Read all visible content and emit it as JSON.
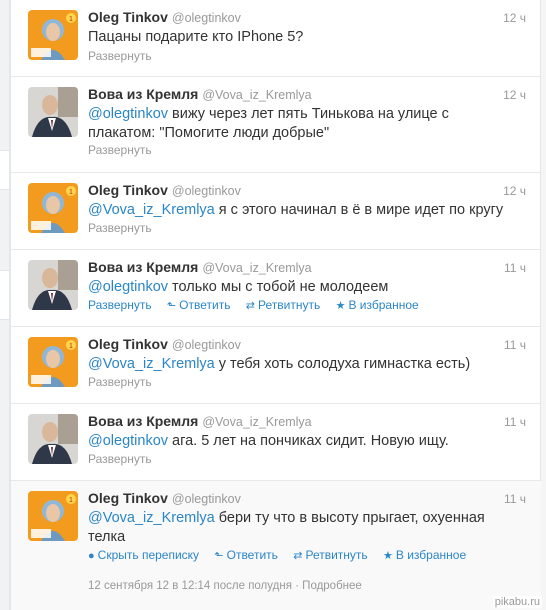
{
  "tweets": [
    {
      "name": "Oleg Tinkov",
      "handle": "@olegtinkov",
      "time": "12 ч",
      "mention": "",
      "text": "Пацаны подарите кто IPhone 5?",
      "expand": "Развернуть"
    },
    {
      "name": "Вова из Кремля",
      "handle": "@Vova_iz_Kremlya",
      "time": "12 ч",
      "mention": "@olegtinkov",
      "text": " вижу через лет пять Тинькова на улице с плакатом: \"Помогите люди добрые\"",
      "expand": "Развернуть"
    },
    {
      "name": "Oleg Tinkov",
      "handle": "@olegtinkov",
      "time": "12 ч",
      "mention": "@Vova_iz_Kremlya",
      "text": " я с этого начинал в ё в мире идет по кругу",
      "expand": "Развернуть"
    },
    {
      "name": "Вова из Кремля",
      "handle": "@Vova_iz_Kremlya",
      "time": "11 ч",
      "mention": "@olegtinkov",
      "text": " только мы с тобой не молодеем",
      "expand": "Развернуть",
      "reply": "Ответить",
      "retweet": "Ретвитнуть",
      "favorite": "В избранное"
    },
    {
      "name": "Oleg Tinkov",
      "handle": "@olegtinkov",
      "time": "11 ч",
      "mention": "@Vova_iz_Kremlya",
      "text": " у тебя хоть солодуха гимнастка есть)",
      "expand": "Развернуть"
    },
    {
      "name": "Вова из Кремля",
      "handle": "@Vova_iz_Kremlya",
      "time": "11 ч",
      "mention": "@olegtinkov",
      "text": " ага. 5 лет на пончиках сидит. Новую ищу.",
      "expand": "Развернуть"
    },
    {
      "name": "Oleg Tinkov",
      "handle": "@olegtinkov",
      "time": "11 ч",
      "mention": "@Vova_iz_Kremlya",
      "text": " бери ту что в высоту прыгает, охуенная телка",
      "hide": "Скрыть переписку",
      "reply": "Ответить",
      "retweet": "Ретвитнуть",
      "favorite": "В избранное",
      "date": "12 сентября 12 в 12:14 после полудня",
      "sep": " · ",
      "details": "Подробнее"
    }
  ],
  "avatar_text": {
    "badge": "1",
    "caption": "КАК СТАТЬ\nМИЛЛИОНЕРОМ"
  },
  "watermark": "pikabu.ru",
  "colors": {
    "link": "#2a86c7",
    "muted": "#999999",
    "text": "#333333"
  }
}
